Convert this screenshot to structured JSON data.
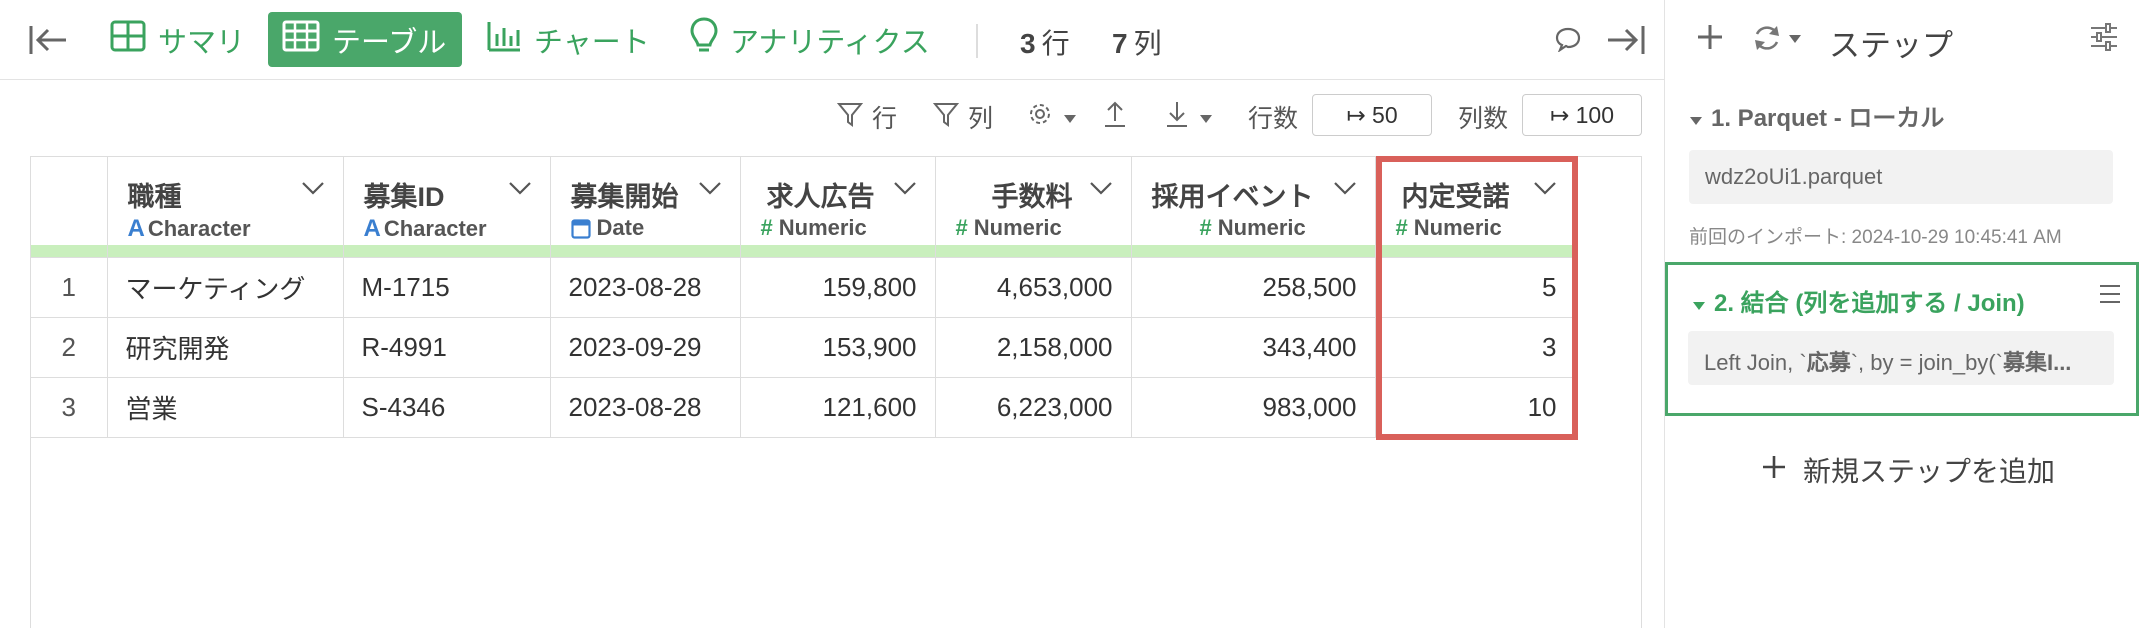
{
  "toolbar": {
    "tabs": [
      {
        "label": "サマリ",
        "active": false
      },
      {
        "label": "テーブル",
        "active": true
      },
      {
        "label": "チャート",
        "active": false
      },
      {
        "label": "アナリティクス",
        "active": false
      }
    ],
    "rows_count": "3",
    "rows_unit": "行",
    "cols_count": "7",
    "cols_unit": "列"
  },
  "subbar": {
    "filter_rows_label": "行",
    "filter_cols_label": "列",
    "rows_label": "行数",
    "rows_value": "↦ 50",
    "cols_label": "列数",
    "cols_value": "↦ 100"
  },
  "table": {
    "columns": [
      {
        "name": "職種",
        "type": "Character",
        "type_icon": "character-icon"
      },
      {
        "name": "募集ID",
        "type": "Character",
        "type_icon": "character-icon"
      },
      {
        "name": "募集開始",
        "type": "Date",
        "type_icon": "calendar-icon"
      },
      {
        "name": "求人広告",
        "type": "Numeric",
        "type_icon": "hash-icon"
      },
      {
        "name": "手数料",
        "type": "Numeric",
        "type_icon": "hash-icon"
      },
      {
        "name": "採用イベント",
        "type": "Numeric",
        "type_icon": "hash-icon"
      },
      {
        "name": "内定受諾",
        "type": "Numeric",
        "type_icon": "hash-icon"
      }
    ],
    "rows": [
      {
        "n": "1",
        "cells": [
          "マーケティング",
          "M-1715",
          "2023-08-28",
          "159,800",
          "4,653,000",
          "258,500",
          "5"
        ]
      },
      {
        "n": "2",
        "cells": [
          "研究開発",
          "R-4991",
          "2023-09-29",
          "153,900",
          "2,158,000",
          "343,400",
          "3"
        ]
      },
      {
        "n": "3",
        "cells": [
          "営業",
          "S-4346",
          "2023-08-28",
          "121,600",
          "6,223,000",
          "983,000",
          "10"
        ]
      }
    ]
  },
  "panel": {
    "title": "ステップ",
    "step1_title": "1. Parquet - ローカル",
    "step1_file": "wdz2oUi1.parquet",
    "step1_import": "前回のインポート: 2024-10-29 10:45:41 AM",
    "step2_title": "2. 結合 (列を追加する / Join)",
    "step2_pre": "Left Join, `",
    "step2_bold1": "応募",
    "step2_mid": "`, by = join_by(`",
    "step2_bold2": "募集I...",
    "add_step_label": "新規ステップを追加"
  },
  "colors": {
    "accent": "#4aa76a",
    "highlight": "#d9605a",
    "header_bar": "#c9efbd",
    "character": "#3a7fd0",
    "date": "#3a7fd0",
    "numeric": "#3aa35e"
  }
}
